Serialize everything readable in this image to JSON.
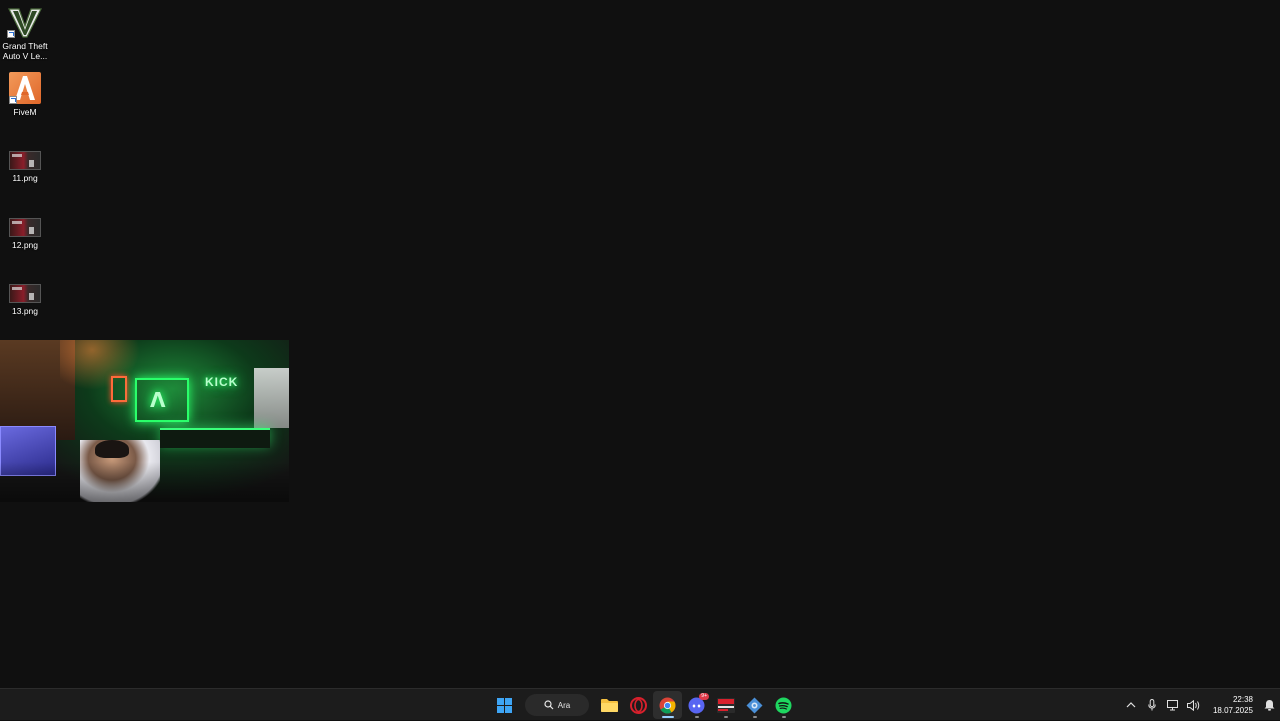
{
  "desktop": {
    "icons": [
      {
        "name": "gta-v",
        "label": "Grand Theft Auto V Le...",
        "icon": "gta-v-logo",
        "shortcut": true
      },
      {
        "name": "fivem",
        "label": "FiveM",
        "icon": "fivem-logo",
        "shortcut": true
      },
      {
        "name": "file-11",
        "label": "11.png",
        "icon": "image-thumbnail",
        "shortcut": false
      },
      {
        "name": "file-12",
        "label": "12.png",
        "icon": "image-thumbnail",
        "shortcut": false
      },
      {
        "name": "file-13",
        "label": "13.png",
        "icon": "image-thumbnail",
        "shortcut": false
      }
    ],
    "background_color": "#101010"
  },
  "webcam": {
    "neon_sign_text": "KICK",
    "neon_logo_text": "Λ",
    "neon_color": "#2aff6a"
  },
  "taskbar": {
    "search_label": "Ara",
    "apps": [
      {
        "name": "start",
        "icon": "windows-icon"
      },
      {
        "name": "file-explorer",
        "icon": "folder-icon",
        "running": false
      },
      {
        "name": "opera",
        "icon": "opera-icon",
        "running": false
      },
      {
        "name": "chrome",
        "icon": "chrome-icon",
        "running": true,
        "active": true
      },
      {
        "name": "discord",
        "icon": "discord-icon",
        "running": true,
        "badge": "9+"
      },
      {
        "name": "video-editor",
        "icon": "video-editor-icon",
        "running": true
      },
      {
        "name": "settings-app",
        "icon": "gear-app-icon",
        "running": true
      },
      {
        "name": "spotify",
        "icon": "spotify-icon",
        "running": true
      }
    ],
    "tray": [
      "chevron-up-icon",
      "microphone-icon",
      "network-icon",
      "volume-icon"
    ],
    "clock": {
      "time": "22:38",
      "date": "18.07.2025"
    },
    "accent_color": "#3ea5f5"
  }
}
